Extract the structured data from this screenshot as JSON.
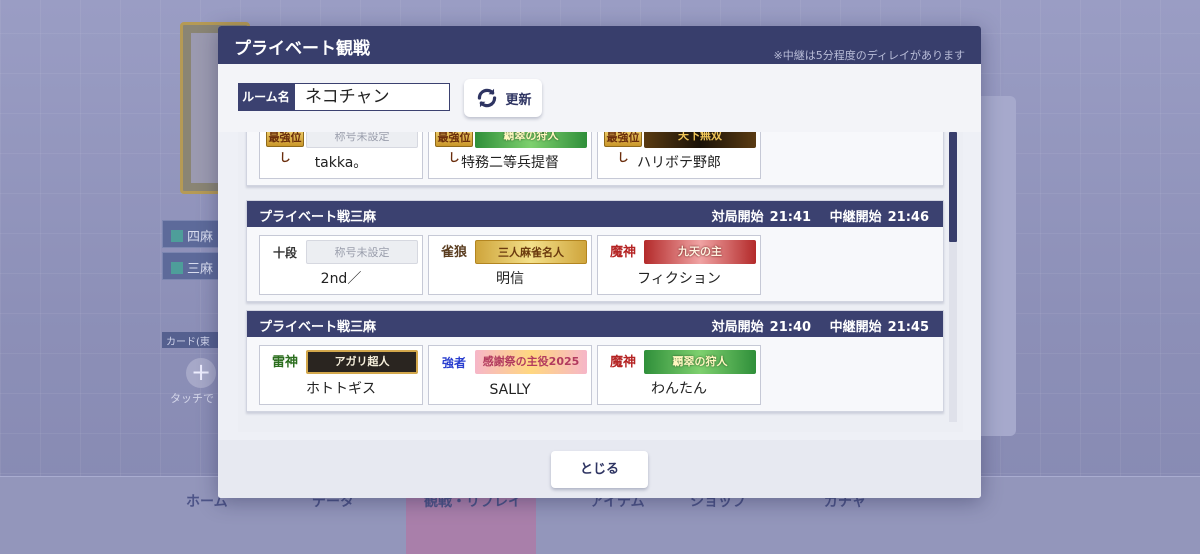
{
  "background": {
    "modes": [
      "四麻",
      "三麻"
    ],
    "card_label": "カード(東",
    "plus": "+",
    "touch_text": "タッチで",
    "nav": [
      {
        "label": "ホーム",
        "icon": "home-icon"
      },
      {
        "label": "データ",
        "icon": "data-icon"
      },
      {
        "label": "観戦・リプレイ",
        "icon": "watch-icon"
      },
      {
        "label": "アイテム",
        "icon": "item-icon"
      },
      {
        "label": "ショップ",
        "icon": "shop-icon"
      },
      {
        "label": "ガチャ",
        "icon": "gacha-icon"
      }
    ]
  },
  "modal": {
    "title": "プライベート観戦",
    "note": "※中継は5分程度のディレイがあります",
    "room_label": "ルーム名",
    "room_value": "ネコチャン",
    "refresh_label": "更新",
    "close_label": "とじる"
  },
  "matches": [
    {
      "title": "",
      "start_label": "",
      "start_time": "",
      "relay_label": "",
      "relay_time": "",
      "players": [
        {
          "rank": "最強位し",
          "title": "称号未設定",
          "name": "takka。"
        },
        {
          "rank": "最強位し",
          "title": "覇翠の狩人",
          "name": "特務二等兵提督"
        },
        {
          "rank": "最強位し",
          "title": "天下無双",
          "name": "ハリボテ野郎"
        }
      ]
    },
    {
      "title": "プライベート戦三麻",
      "start_label": "対局開始",
      "start_time": "21:41",
      "relay_label": "中継開始",
      "relay_time": "21:46",
      "players": [
        {
          "rank": "十段",
          "title": "称号未設定",
          "name": "2nd／"
        },
        {
          "rank": "雀狼",
          "title": "三人麻雀名人",
          "name": "明信"
        },
        {
          "rank": "魔神",
          "title": "九天の主",
          "name": "フィクション"
        }
      ]
    },
    {
      "title": "プライベート戦三麻",
      "start_label": "対局開始",
      "start_time": "21:40",
      "relay_label": "中継開始",
      "relay_time": "21:45",
      "players": [
        {
          "rank": "雷神",
          "title": "アガリ超人",
          "name": "ホトトギス"
        },
        {
          "rank": "強者",
          "title": "感謝祭の主役2025",
          "name": "SALLY"
        },
        {
          "rank": "魔神",
          "title": "覇翠の狩人",
          "name": "わんたん"
        }
      ]
    }
  ],
  "colors": {
    "header": "#383e6c",
    "modal_bg": "#eef0f6",
    "accent": "#3b4170"
  }
}
